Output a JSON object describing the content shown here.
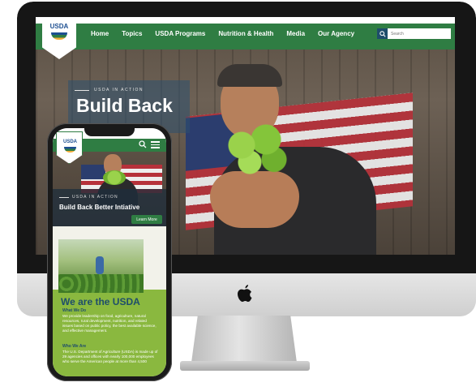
{
  "desktop": {
    "logo_text": "USDA",
    "nav": [
      "Home",
      "Topics",
      "USDA Programs",
      "Nutrition & Health",
      "Media",
      "Our Agency"
    ],
    "search_placeholder": "Search",
    "hero": {
      "eyebrow": "USDA IN ACTION",
      "title": "Build Back"
    }
  },
  "mobile": {
    "logo_text": "USDA",
    "hero": {
      "eyebrow": "USDA IN ACTION",
      "title": "Build Back Better Intiative",
      "button": "Learn More"
    },
    "about": {
      "heading": "We are the USDA",
      "what_title": "What We Do",
      "what_text": "We provide leadership on food, agriculture, natural resources, rural development, nutrition, and related issues based on public policy, the best available science, and effective management.",
      "who_title": "Who We Are",
      "who_text": "The U.S. Department of Agriculture (USDA) is made up of 29 agencies and offices with nearly 100,000 employees who serve the American people at more than 4,500"
    }
  },
  "colors": {
    "nav_green": "#2f7d43",
    "brand_blue": "#1d4f91",
    "accent_green": "#8ab83f"
  },
  "icons": [
    "apple-logo-icon",
    "search-icon",
    "menu-icon"
  ]
}
